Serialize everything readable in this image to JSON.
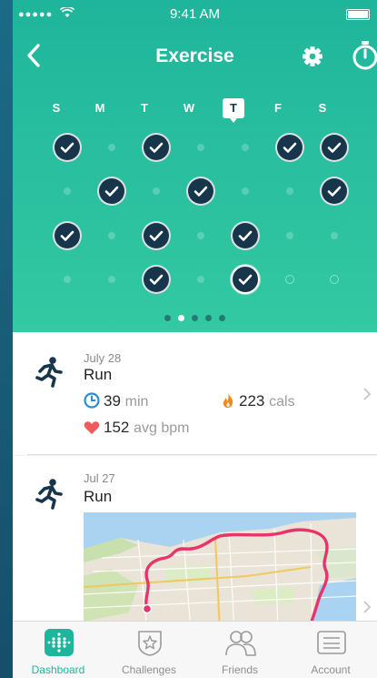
{
  "status": {
    "time": "9:41 AM"
  },
  "header": {
    "title": "Exercise"
  },
  "week_days": [
    {
      "label": "S",
      "today": false
    },
    {
      "label": "M",
      "today": false
    },
    {
      "label": "T",
      "today": false
    },
    {
      "label": "W",
      "today": false
    },
    {
      "label": "T",
      "today": true
    },
    {
      "label": "F",
      "today": false
    },
    {
      "label": "S",
      "today": false
    }
  ],
  "calendar_weeks": [
    [
      "check",
      "dot",
      "check",
      "dot",
      "dot",
      "check",
      "check"
    ],
    [
      "dot",
      "check",
      "dot",
      "check",
      "dot",
      "dot",
      "check"
    ],
    [
      "check",
      "dot",
      "check",
      "dot",
      "check",
      "dot",
      "dot"
    ],
    [
      "dot",
      "dot",
      "check",
      "dot",
      "today-check",
      "ring",
      "ring"
    ]
  ],
  "pager": {
    "count": 5,
    "active": 1
  },
  "activities": [
    {
      "date": "July 28",
      "type": "Run",
      "duration_value": "39",
      "duration_unit": "min",
      "calories_value": "223",
      "calories_unit": "cals",
      "heart_value": "152",
      "heart_unit": "avg bpm"
    },
    {
      "date": "Jul 27",
      "type": "Run"
    }
  ],
  "tabs": [
    {
      "label": "Dashboard",
      "icon": "dashboard-icon",
      "active": true
    },
    {
      "label": "Challenges",
      "icon": "challenges-icon",
      "active": false
    },
    {
      "label": "Friends",
      "icon": "friends-icon",
      "active": false
    },
    {
      "label": "Account",
      "icon": "account-icon",
      "active": false
    }
  ],
  "colors": {
    "accent": "#1fb59c",
    "navy": "#17364b",
    "duration": "#2b8fd6",
    "calories": "#f08a1c",
    "heart": "#ef5a5a",
    "route": "#e8336b"
  }
}
